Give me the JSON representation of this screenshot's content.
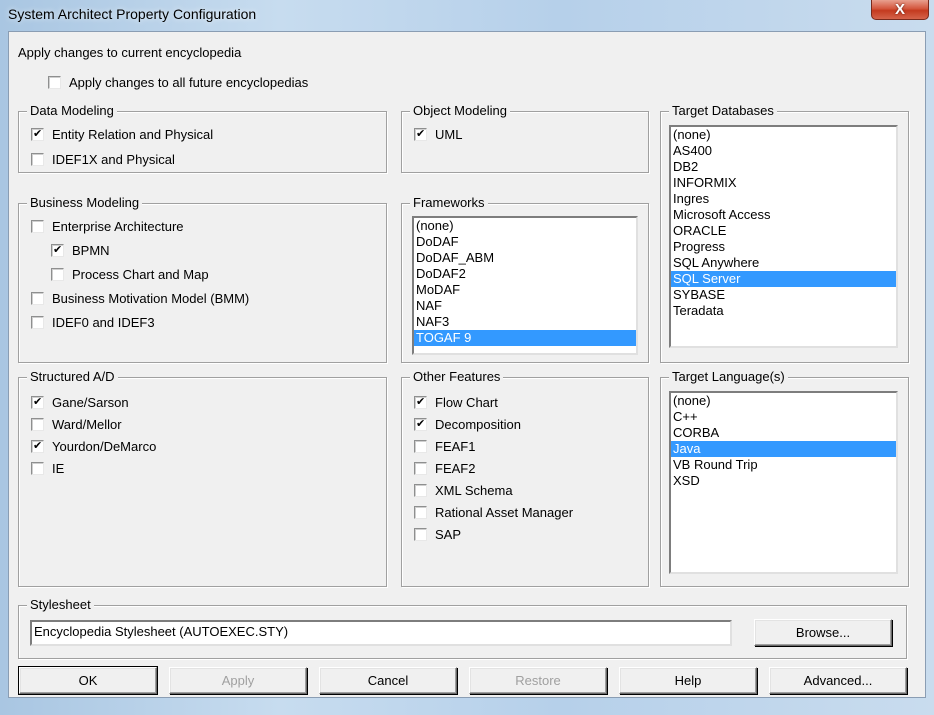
{
  "window": {
    "title": "System Architect Property Configuration",
    "close_label": "X"
  },
  "header": {
    "apply_current_label": "Apply changes to current encyclopedia",
    "apply_future": {
      "label": "Apply changes to all future encyclopedias",
      "checked": false
    }
  },
  "data_modeling": {
    "title": "Data Modeling",
    "items": [
      {
        "label": "Entity Relation and Physical",
        "checked": true
      },
      {
        "label": "IDEF1X and Physical",
        "checked": false
      }
    ]
  },
  "business_modeling": {
    "title": "Business Modeling",
    "items": [
      {
        "label": "Enterprise Architecture",
        "checked": false
      },
      {
        "label": "BPMN",
        "checked": true
      },
      {
        "label": "Process Chart and Map",
        "checked": false
      },
      {
        "label": "Business Motivation Model (BMM)",
        "checked": false
      },
      {
        "label": "IDEF0 and IDEF3",
        "checked": false
      }
    ]
  },
  "structured_ad": {
    "title": "Structured A/D",
    "items": [
      {
        "label": "Gane/Sarson",
        "checked": true
      },
      {
        "label": "Ward/Mellor",
        "checked": false
      },
      {
        "label": "Yourdon/DeMarco",
        "checked": true
      },
      {
        "label": "IE",
        "checked": false
      }
    ]
  },
  "object_modeling": {
    "title": "Object Modeling",
    "items": [
      {
        "label": "UML",
        "checked": true
      }
    ]
  },
  "frameworks": {
    "title": "Frameworks",
    "items": [
      "(none)",
      "DoDAF",
      "DoDAF_ABM",
      "DoDAF2",
      "MoDAF",
      "NAF",
      "NAF3",
      "TOGAF 9"
    ],
    "selected": "TOGAF 9"
  },
  "other_features": {
    "title": "Other Features",
    "items": [
      {
        "label": "Flow Chart",
        "checked": true
      },
      {
        "label": "Decomposition",
        "checked": true
      },
      {
        "label": "FEAF1",
        "checked": false
      },
      {
        "label": "FEAF2",
        "checked": false
      },
      {
        "label": "XML Schema",
        "checked": false
      },
      {
        "label": "Rational Asset Manager",
        "checked": false
      },
      {
        "label": "SAP",
        "checked": false
      }
    ]
  },
  "target_databases": {
    "title": "Target Databases",
    "items": [
      "(none)",
      "AS400",
      "DB2",
      "INFORMIX",
      "Ingres",
      "Microsoft Access",
      "ORACLE",
      "Progress",
      "SQL Anywhere",
      "SQL Server",
      "SYBASE",
      "Teradata"
    ],
    "selected": "SQL Server"
  },
  "target_languages": {
    "title": "Target Language(s)",
    "items": [
      "(none)",
      "C++",
      "CORBA",
      "Java",
      "VB Round Trip",
      "XSD"
    ],
    "selected": "Java"
  },
  "stylesheet": {
    "title": "Stylesheet",
    "value": "Encyclopedia Stylesheet (AUTOEXEC.STY)",
    "browse_label": "Browse..."
  },
  "buttons": {
    "ok": "OK",
    "apply": "Apply",
    "cancel": "Cancel",
    "restore": "Restore",
    "help": "Help",
    "advanced": "Advanced..."
  },
  "colors": {
    "selection": "#3399ff",
    "close_button": "#c43a1f",
    "dialog_bg": "#f0f0f0"
  }
}
